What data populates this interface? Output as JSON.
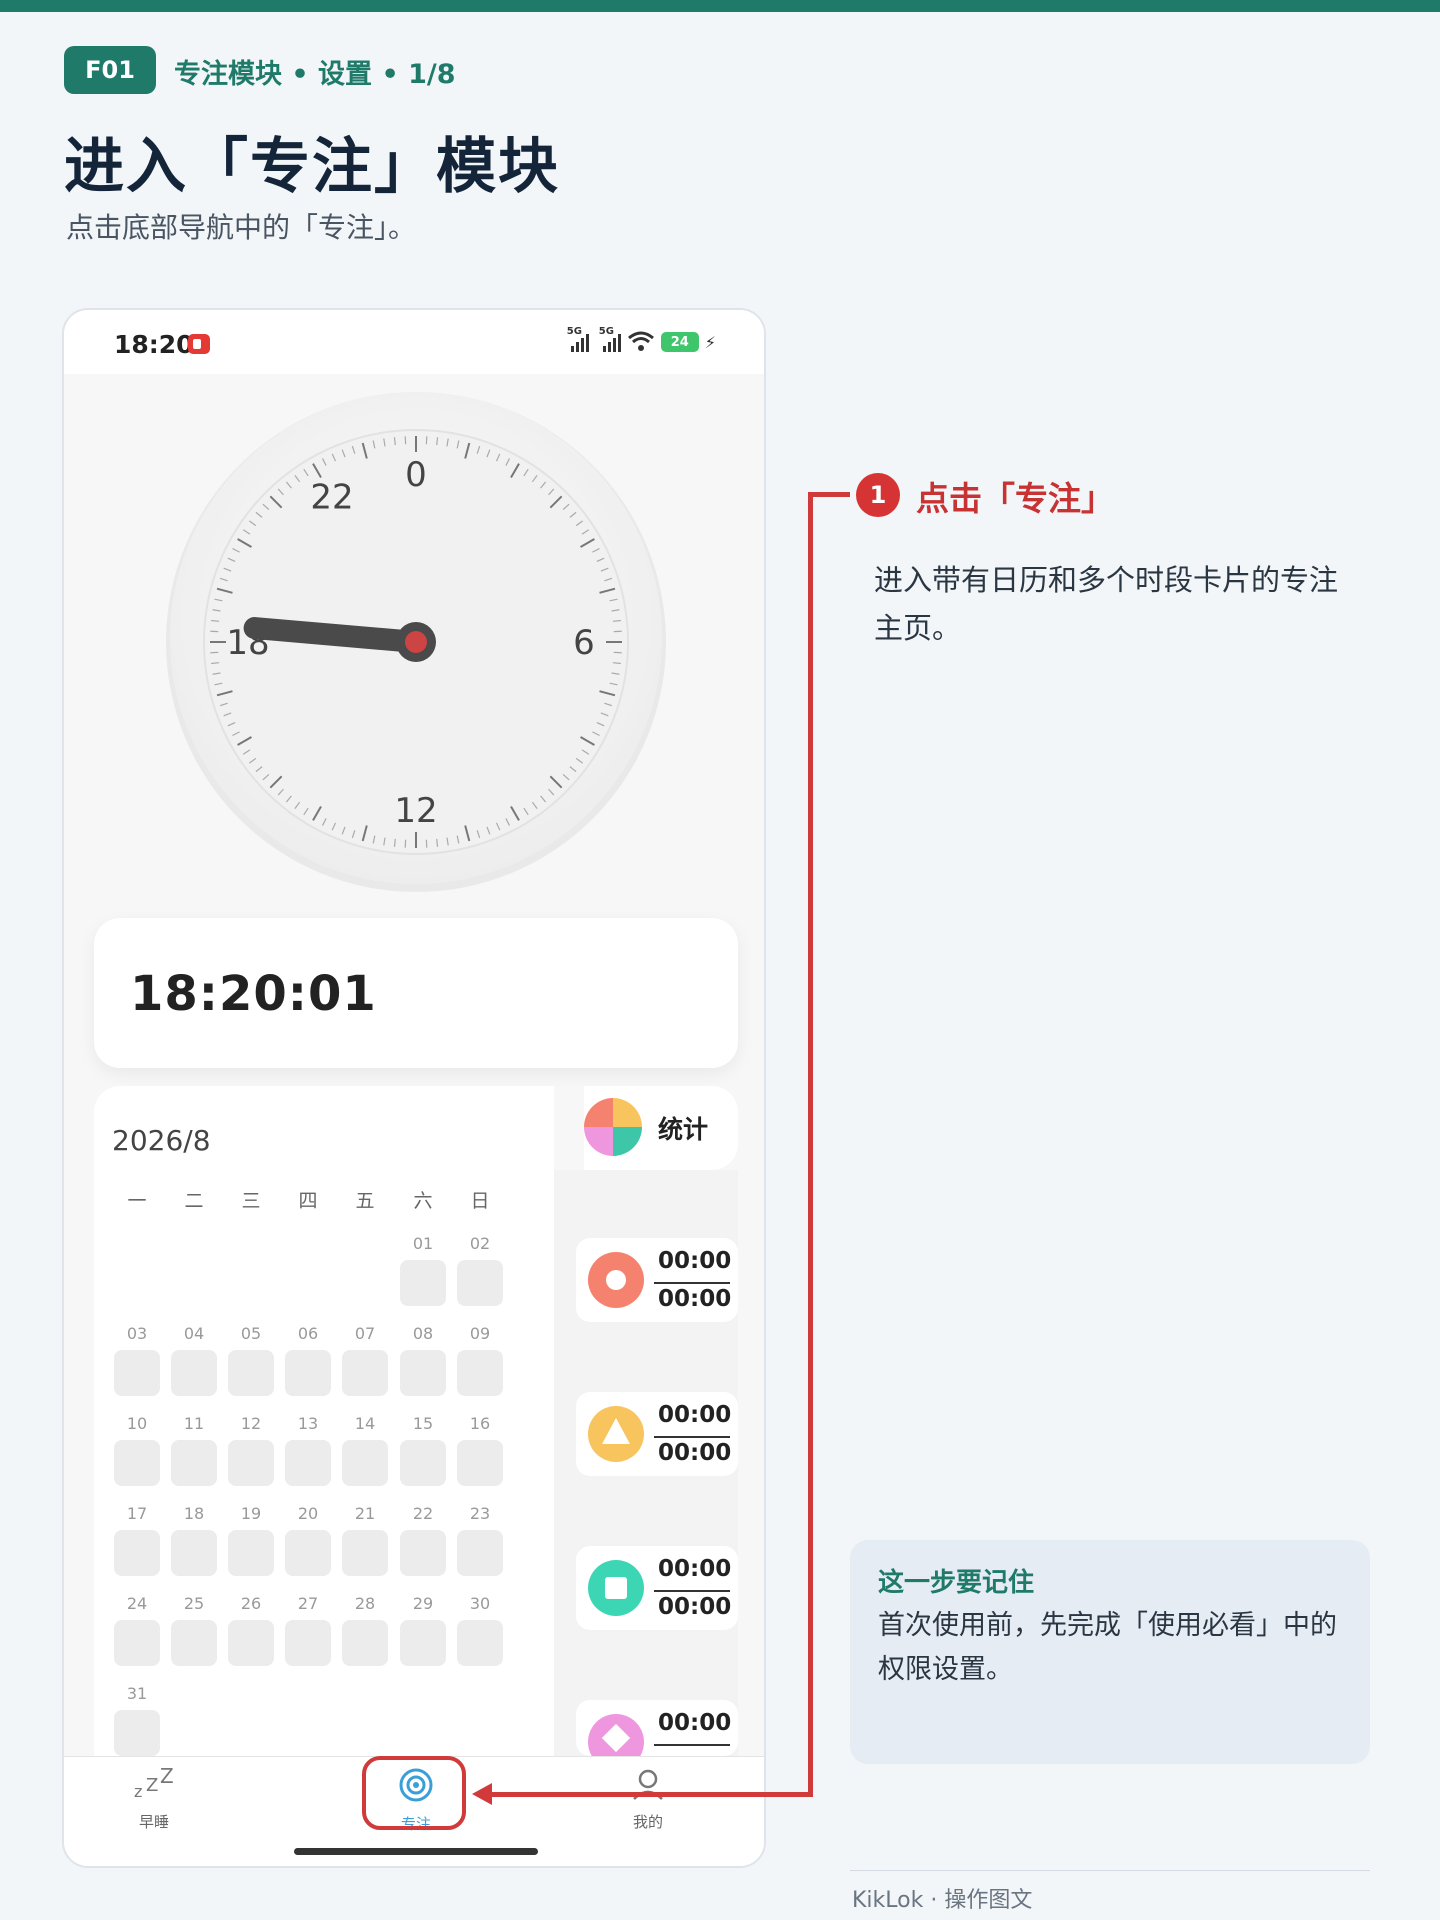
{
  "header": {
    "badge": "F01",
    "breadcrumb": "专注模块 • 设置 • 1/8",
    "title": "进入「专注」模块",
    "subtitle": "点击底部导航中的「专注」。"
  },
  "phone": {
    "status_time": "18:20",
    "network_1": "5G",
    "network_2": "5G",
    "battery": "24",
    "clock": {
      "labels": [
        "0",
        "6",
        "12",
        "18",
        "22"
      ],
      "hour_value": 18.33
    },
    "digital_time": "18:20:01",
    "calendar": {
      "month": "2026/8",
      "weekdays": [
        "一",
        "二",
        "三",
        "四",
        "五",
        "六",
        "日"
      ],
      "days": [
        "01",
        "02",
        "03",
        "04",
        "05",
        "06",
        "07",
        "08",
        "09",
        "10",
        "11",
        "12",
        "13",
        "14",
        "15",
        "16",
        "17",
        "18",
        "19",
        "20",
        "21",
        "22",
        "23",
        "24",
        "25",
        "26",
        "27",
        "28",
        "29",
        "30",
        "31"
      ]
    },
    "stats_label": "统计",
    "slots": [
      {
        "start": "00:00",
        "end": "00:00",
        "color": "#f5826f",
        "icon": "circle-icon"
      },
      {
        "start": "00:00",
        "end": "00:00",
        "color": "#f7c45e",
        "icon": "triangle-icon"
      },
      {
        "start": "00:00",
        "end": "00:00",
        "color": "#3dd6b4",
        "icon": "square-icon"
      },
      {
        "start": "00:00",
        "end": "",
        "color": "#ee97de",
        "icon": "diamond-icon"
      }
    ],
    "nav": [
      {
        "label": "早睡",
        "icon": "sleep-icon"
      },
      {
        "label": "专注",
        "icon": "target-icon"
      },
      {
        "label": "我的",
        "icon": "user-icon"
      }
    ]
  },
  "annotation": {
    "step_number": "1",
    "step_title": "点击「专注」",
    "step_description": "进入带有日历和多个时段卡片的专注主页。",
    "accent_color": "#d13a3a"
  },
  "tip": {
    "title": "这一步要记住",
    "text": "首次使用前，先完成「使用必看」中的权限设置。"
  },
  "footer": "KikLok · 操作图文"
}
